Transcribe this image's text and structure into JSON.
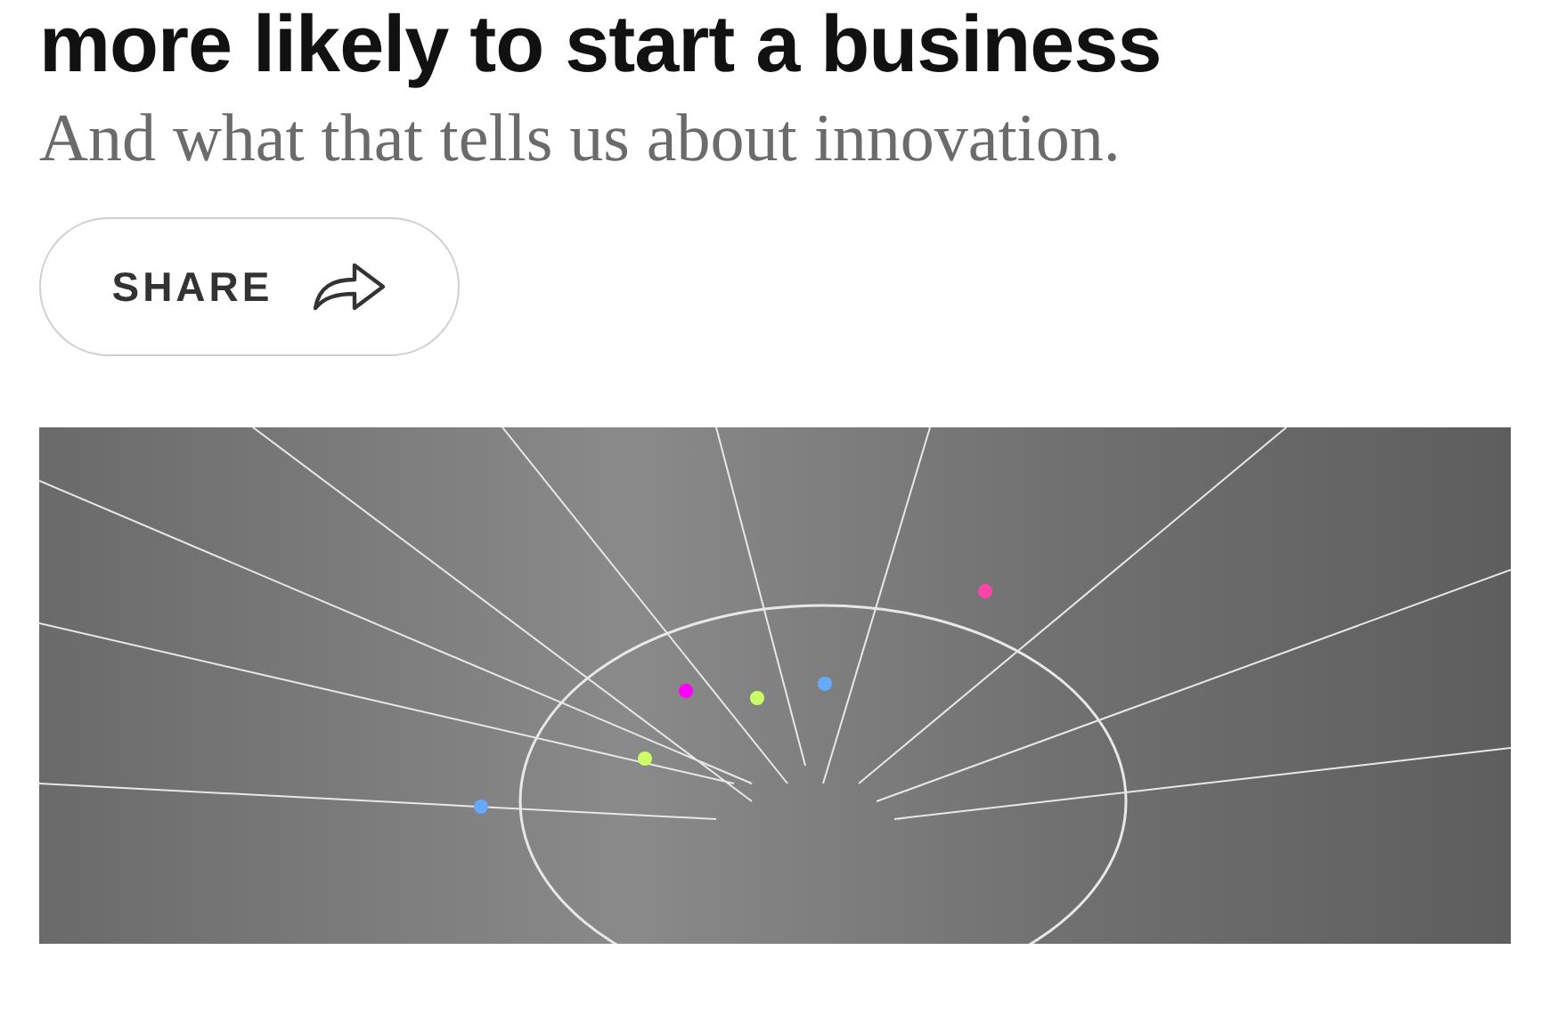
{
  "headline": "more likely to start a business",
  "subtitle": "And what that tells us about innovation.",
  "share_button": {
    "label": "SHARE"
  }
}
